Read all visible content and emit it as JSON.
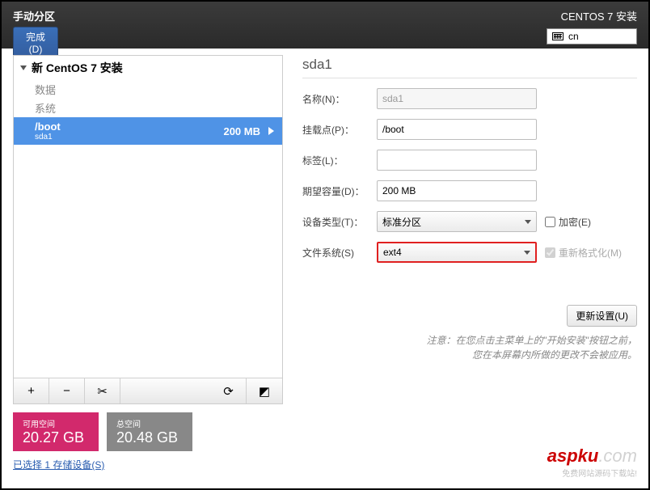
{
  "header": {
    "title": "手动分区",
    "done": "完成(D)",
    "brand": "CENTOS 7 安装",
    "lang": "cn"
  },
  "tree": {
    "root": "新 CentOS 7 安装",
    "groups": [
      "数据",
      "系统"
    ],
    "selected": {
      "mount": "/boot",
      "device": "sda1",
      "size": "200 MB"
    }
  },
  "toolbar": {
    "add": "+",
    "remove": "−",
    "tools": "✂",
    "reload": "⟳",
    "help": "◩"
  },
  "details": {
    "title": "sda1",
    "labels": {
      "name": "名称(N)：",
      "mount": "挂载点(P)：",
      "label": "标签(L)：",
      "capacity": "期望容量(D)：",
      "devtype": "设备类型(T)：",
      "fs": "文件系统(S)",
      "encrypt": "加密(E)",
      "reformat": "重新格式化(M)",
      "update": "更新设置(U)"
    },
    "values": {
      "name": "sda1",
      "mount": "/boot",
      "label": "",
      "capacity": "200 MB",
      "devtype": "标准分区",
      "fs": "ext4"
    },
    "note1": "注意：在您点击主菜单上的\"开始安装\"按钮之前，",
    "note2": "您在本屏幕内所做的更改不会被应用。"
  },
  "space": {
    "avail_label": "可用空间",
    "avail_value": "20.27 GB",
    "total_label": "总空间",
    "total_value": "20.48 GB"
  },
  "storage_link": "已选择 1 存储设备(S)",
  "watermark": {
    "text": "aspku",
    "suffix": ".com",
    "sub": "免费网站源码下载站!"
  }
}
